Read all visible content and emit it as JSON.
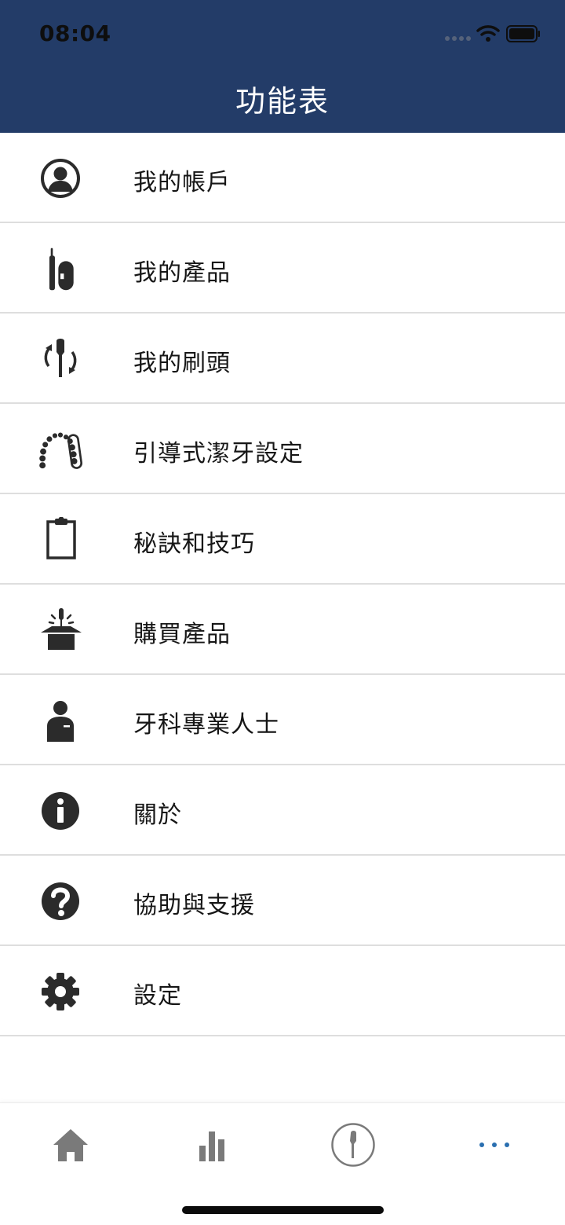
{
  "status_bar": {
    "time": "08:04"
  },
  "header": {
    "title": "功能表"
  },
  "menu": [
    {
      "label": "我的帳戶",
      "icon": "account-icon"
    },
    {
      "label": "我的產品",
      "icon": "toothbrush-product-icon"
    },
    {
      "label": "我的刷頭",
      "icon": "brush-head-replace-icon"
    },
    {
      "label": "引導式潔牙設定",
      "icon": "teeth-arch-icon"
    },
    {
      "label": "秘訣和技巧",
      "icon": "clipboard-icon"
    },
    {
      "label": "購買產品",
      "icon": "product-box-icon"
    },
    {
      "label": "牙科專業人士",
      "icon": "dental-professional-icon"
    },
    {
      "label": "關於",
      "icon": "info-icon"
    },
    {
      "label": "協助與支援",
      "icon": "help-icon"
    },
    {
      "label": "設定",
      "icon": "gear-icon"
    }
  ],
  "tab_bar": {
    "items": [
      "home-icon",
      "stats-icon",
      "toothbrush-icon",
      "more-icon"
    ],
    "active_color": "#2a6fb0",
    "inactive_color": "#7a7a7a"
  },
  "colors": {
    "header_bg": "#233c68",
    "icon": "#2b2b2b",
    "divider": "#dedede"
  }
}
